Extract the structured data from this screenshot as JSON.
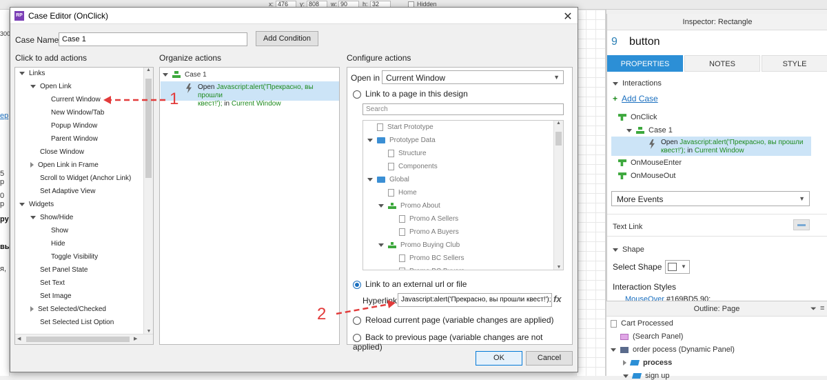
{
  "toolbar": {
    "x_label": "x:",
    "x_value": "476",
    "y_label": "y:",
    "y_value": "808",
    "w_label": "w:",
    "w_value": "90",
    "h_label": "h:",
    "h_value": "32",
    "hidden_label": "Hidden"
  },
  "canvas_left_fragments": [
    "300",
    "ер",
    "5 р",
    "0 р",
    "ру",
    "вы",
    "я,"
  ],
  "dialog": {
    "title": "Case Editor (OnClick)",
    "case_name_label": "Case Name",
    "case_name_value": "Case 1",
    "add_condition": "Add Condition",
    "col1_title": "Click to add actions",
    "col2_title": "Organize actions",
    "col3_title": "Configure actions",
    "actions_tree": [
      {
        "label": "Links",
        "level": 0,
        "expanded": true
      },
      {
        "label": "Open Link",
        "level": 1,
        "expanded": true
      },
      {
        "label": "Current Window",
        "level": 2
      },
      {
        "label": "New Window/Tab",
        "level": 2
      },
      {
        "label": "Popup Window",
        "level": 2
      },
      {
        "label": "Parent Window",
        "level": 2
      },
      {
        "label": "Close Window",
        "level": 1
      },
      {
        "label": "Open Link in Frame",
        "level": 1,
        "collapsed": true
      },
      {
        "label": "Scroll to Widget (Anchor Link)",
        "level": 1
      },
      {
        "label": "Set Adaptive View",
        "level": 1
      },
      {
        "label": "Widgets",
        "level": 0,
        "expanded": true
      },
      {
        "label": "Show/Hide",
        "level": 1,
        "expanded": true
      },
      {
        "label": "Show",
        "level": 2
      },
      {
        "label": "Hide",
        "level": 2
      },
      {
        "label": "Toggle Visibility",
        "level": 2
      },
      {
        "label": "Set Panel State",
        "level": 1
      },
      {
        "label": "Set Text",
        "level": 1
      },
      {
        "label": "Set Image",
        "level": 1
      },
      {
        "label": "Set Selected/Checked",
        "level": 1,
        "collapsed": true
      },
      {
        "label": "Set Selected List Option",
        "level": 1
      }
    ],
    "organize": {
      "case_label": "Case 1",
      "action_prefix": "Open ",
      "action_js_1": "Javascript:alert('Прекрасно, вы прошли",
      "action_js_2": "квест!');",
      "action_in": " in ",
      "action_target": "Current Window"
    },
    "configure": {
      "open_in_label": "Open in",
      "open_in_value": "Current Window",
      "link_page_label": "Link to a page in this design",
      "search_placeholder": "Search",
      "pages": [
        {
          "label": "Start Prototype",
          "level": 0,
          "icon": "page"
        },
        {
          "label": "Prototype Data",
          "level": 0,
          "icon": "folder",
          "expanded": true
        },
        {
          "label": "Structure",
          "level": 1,
          "icon": "page"
        },
        {
          "label": "Components",
          "level": 1,
          "icon": "page"
        },
        {
          "label": "Global",
          "level": 0,
          "icon": "folder",
          "expanded": true
        },
        {
          "label": "Home",
          "level": 1,
          "icon": "page"
        },
        {
          "label": "Promo About",
          "level": 1,
          "icon": "flow",
          "expanded": true
        },
        {
          "label": "Promo A Sellers",
          "level": 2,
          "icon": "page"
        },
        {
          "label": "Promo A Buyers",
          "level": 2,
          "icon": "page"
        },
        {
          "label": "Promo Buying Club",
          "level": 1,
          "icon": "flow",
          "expanded": true
        },
        {
          "label": "Promo BC Sellers",
          "level": 2,
          "icon": "page"
        },
        {
          "label": "Promo BC Buyers",
          "level": 2,
          "icon": "page"
        }
      ],
      "link_external_label": "Link to an external url or file",
      "hyperlink_label": "Hyperlink",
      "hyperlink_value": "Javascript:alert('Прекрасно, вы прошли квест!');",
      "fx_label": "fx",
      "reload_label": "Reload current page (variable changes are applied)",
      "back_label": "Back to previous page (variable changes are not applied)"
    },
    "ok_label": "OK",
    "cancel_label": "Cancel"
  },
  "annotations": {
    "one": "1",
    "two": "2",
    "color": "#e23b3b"
  },
  "inspector": {
    "title": "Inspector: Rectangle",
    "number": "9",
    "name": "button",
    "tabs": [
      "PROPERTIES",
      "NOTES",
      "STYLE"
    ],
    "interactions_label": "Interactions",
    "add_case": "Add Case",
    "onclick": "OnClick",
    "case_label": "Case 1",
    "action_prefix": "Open ",
    "action_js_1": "Javascript:alert('Прекрасно, вы прошли",
    "action_js_2": "квест!');",
    "action_in": " in ",
    "action_target": "Current Window",
    "onmouseenter": "OnMouseEnter",
    "onmouseout": "OnMouseOut",
    "more_events": "More Events",
    "text_link": "Text Link",
    "shape_label": "Shape",
    "select_shape": "Select Shape",
    "interaction_styles": "Interaction Styles",
    "mouseover_partial": "MouseOver",
    "mouseover_value": "#169BD5,90;"
  },
  "outline": {
    "title": "Outline: Page",
    "items": [
      {
        "label": "Cart Processed",
        "icon": "page"
      },
      {
        "label": "(Search Panel)",
        "icon": "panel"
      },
      {
        "label": "order pocess (Dynamic Panel)",
        "icon": "dynamic"
      },
      {
        "label": "process",
        "icon": "state",
        "bold": true
      },
      {
        "label": "sign up",
        "icon": "state"
      }
    ]
  },
  "colors": {
    "accent": "#2c8fd6",
    "green_text": "#1e8a1e",
    "annotation": "#e23b3b"
  }
}
